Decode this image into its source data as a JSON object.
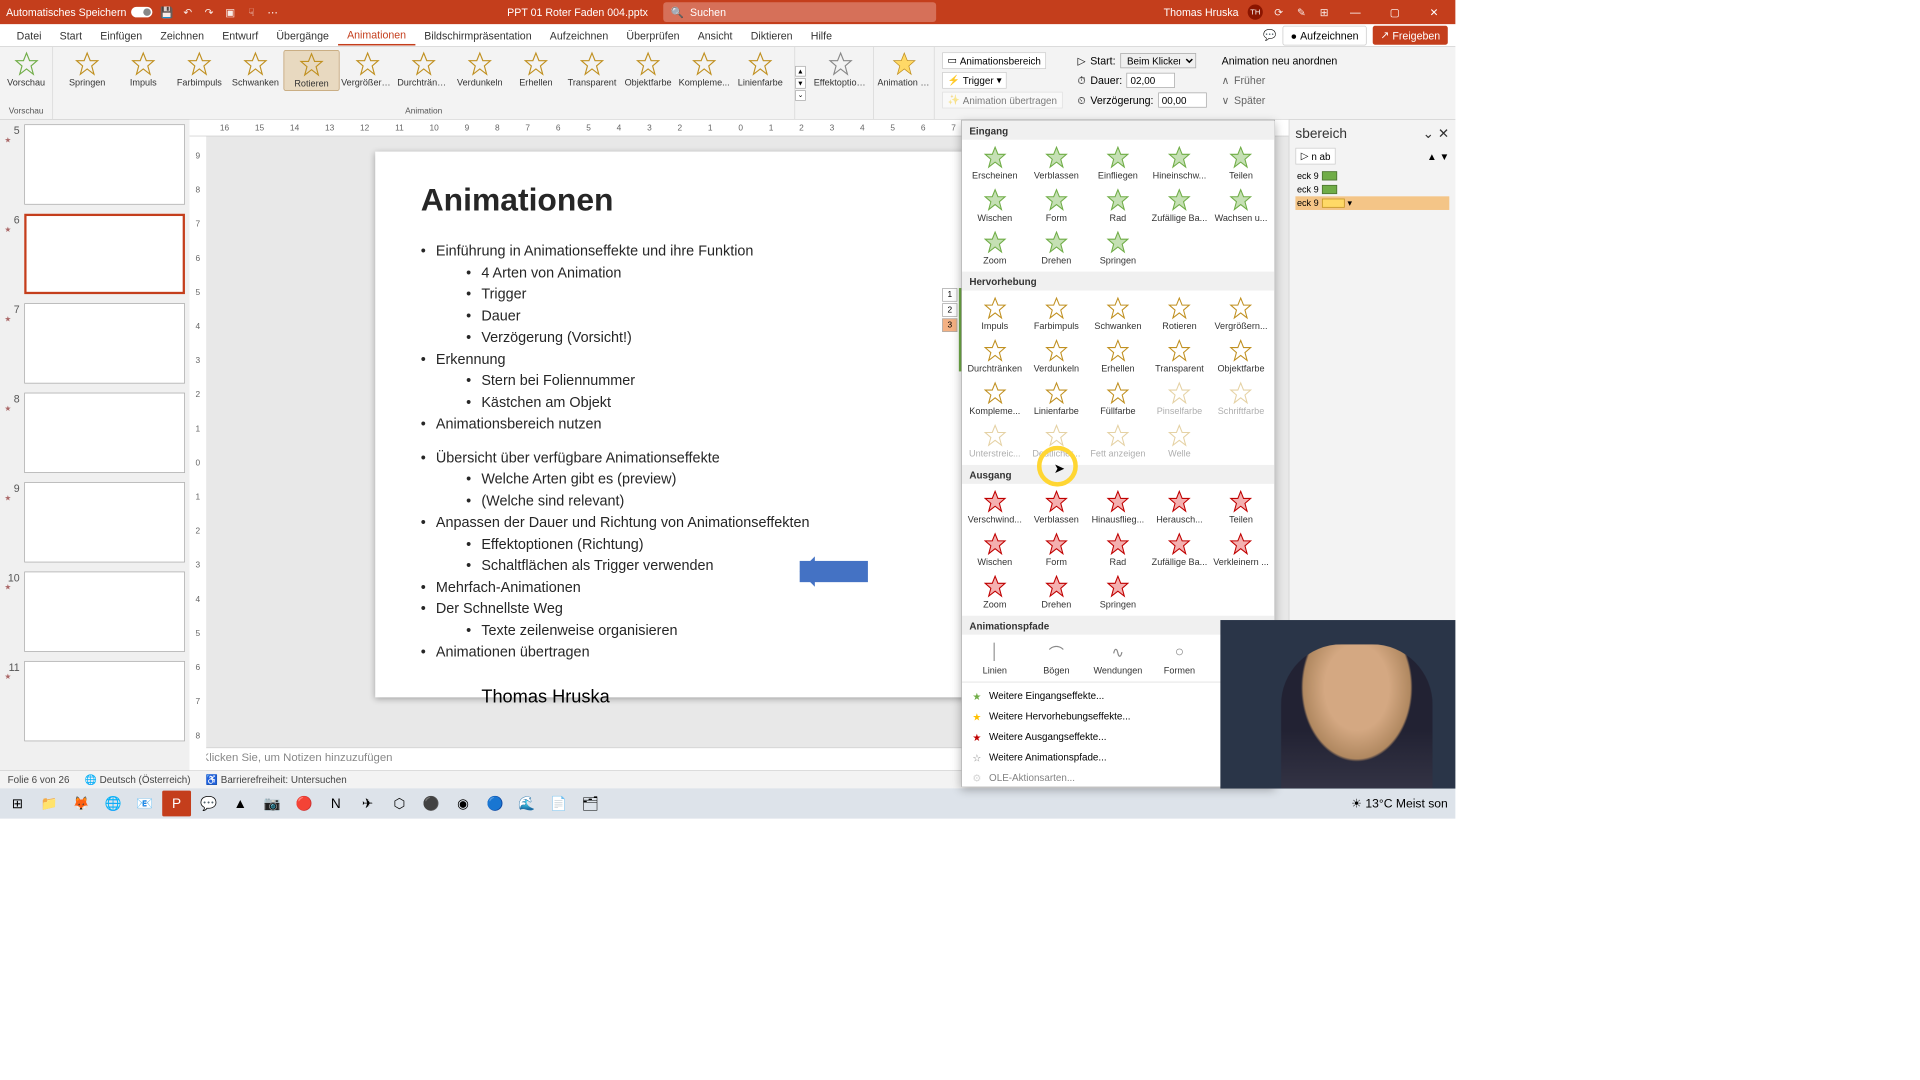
{
  "titlebar": {
    "autosave": "Automatisches Speichern",
    "filename": "PPT 01 Roter Faden 004.pptx",
    "search_placeholder": "Suchen",
    "username": "Thomas Hruska",
    "user_initials": "TH"
  },
  "menu": {
    "items": [
      "Datei",
      "Start",
      "Einfügen",
      "Zeichnen",
      "Entwurf",
      "Übergänge",
      "Animationen",
      "Bildschirmpräsentation",
      "Aufzeichnen",
      "Überprüfen",
      "Ansicht",
      "Diktieren",
      "Hilfe"
    ],
    "active_index": 6,
    "record": "Aufzeichnen",
    "share": "Freigeben"
  },
  "ribbon": {
    "preview": "Vorschau",
    "preview_group": "Vorschau",
    "animation_group": "Animation",
    "gallery": [
      "Springen",
      "Impuls",
      "Farbimpuls",
      "Schwanken",
      "Rotieren",
      "Vergrößern/...",
      "Durchtränken",
      "Verdunkeln",
      "Erhellen",
      "Transparent",
      "Objektfarbe",
      "Kompleme...",
      "Linienfarbe"
    ],
    "gallery_selected": 4,
    "effect_options": "Effektoptionen",
    "add_animation": "Animation hinzufügen",
    "anim_pane_btn": "Animationsbereich",
    "trigger": "Trigger",
    "anim_transfer": "Animation übertragen",
    "start_label": "Start:",
    "start_value": "Beim Klicken",
    "duration_label": "Dauer:",
    "duration_value": "02,00",
    "delay_label": "Verzögerung:",
    "delay_value": "00,00",
    "reorder": "Animation neu anordnen",
    "earlier": "Früher",
    "later": "Später"
  },
  "thumbs": [
    {
      "num": "5",
      "star": true
    },
    {
      "num": "6",
      "star": true,
      "selected": true
    },
    {
      "num": "7",
      "star": true
    },
    {
      "num": "8",
      "star": true
    },
    {
      "num": "9",
      "star": true
    },
    {
      "num": "10",
      "star": true
    },
    {
      "num": "11",
      "star": true
    }
  ],
  "slide": {
    "title": "Animationen",
    "bullets": [
      "Einführung in Animationseffekte und ihre Funktion",
      "Erkennung",
      "Animationsbereich nutzen",
      "Übersicht über verfügbare Animationseffekte",
      "Anpassen der Dauer und Richtung von Animationseffekten",
      "Mehrfach-Animationen",
      "Der Schnellste Weg",
      "Animationen übertragen"
    ],
    "sub_bullets_0": [
      "4 Arten von Animation",
      "Trigger",
      "Dauer",
      "Verzögerung (Vorsicht!)"
    ],
    "sub_bullets_1": [
      "Stern bei Foliennummer",
      "Kästchen am Objekt"
    ],
    "sub_bullets_3": [
      "Welche Arten gibt es (preview)",
      "(Welche sind relevant)"
    ],
    "sub_bullets_4": [
      "Effektoptionen (Richtung)",
      "Schaltflächen als Trigger verwenden"
    ],
    "sub_bullets_6": [
      "Texte zeilenweise organisieren"
    ],
    "author": "Thomas Hruska",
    "tags": [
      "1",
      "2",
      "3"
    ]
  },
  "notes": "Klicken Sie, um Notizen hinzuzufügen",
  "dropdown": {
    "sections": {
      "entrance": "Eingang",
      "emphasis": "Hervorhebung",
      "exit": "Ausgang",
      "paths": "Animationspfade"
    },
    "entrance_items": [
      "Erscheinen",
      "Verblassen",
      "Einfliegen",
      "Hineinschw...",
      "Teilen",
      "Wischen",
      "Form",
      "Rad",
      "Zufällige Ba...",
      "Wachsen u...",
      "Zoom",
      "Drehen",
      "Springen"
    ],
    "emphasis_items": [
      "Impuls",
      "Farbimpuls",
      "Schwanken",
      "Rotieren",
      "Vergrößern...",
      "Durchtränken",
      "Verdunkeln",
      "Erhellen",
      "Transparent",
      "Objektfarbe",
      "Kompleme...",
      "Linienfarbe",
      "Füllfarbe",
      "Pinselfarbe",
      "Schriftfarbe",
      "Unterstreic...",
      "Deutlicher...",
      "Fett anzeigen",
      "Welle"
    ],
    "emphasis_disabled": [
      13,
      14,
      15,
      16,
      17,
      18
    ],
    "exit_items": [
      "Verschwind...",
      "Verblassen",
      "Hinausflieg...",
      "Herausch...",
      "Teilen",
      "Wischen",
      "Form",
      "Rad",
      "Zufällige Ba...",
      "Verkleinern ...",
      "Zoom",
      "Drehen",
      "Springen"
    ],
    "path_items": [
      "Linien",
      "Bögen",
      "Wendungen",
      "Formen"
    ],
    "footer": [
      "Weitere Eingangseffekte...",
      "Weitere Hervorhebungseffekte...",
      "Weitere Ausgangseffekte...",
      "Weitere Animationspfade...",
      "OLE-Aktionsarten..."
    ]
  },
  "anim_pane": {
    "title": "sbereich",
    "play": "n ab",
    "items": [
      "eck 9",
      "eck 9",
      "eck 9"
    ]
  },
  "statusbar": {
    "slide_info": "Folie 6 von 26",
    "language": "Deutsch (Österreich)",
    "accessibility": "Barrierefreiheit: Untersuchen"
  },
  "taskbar": {
    "weather": "13°C  Meist son"
  }
}
